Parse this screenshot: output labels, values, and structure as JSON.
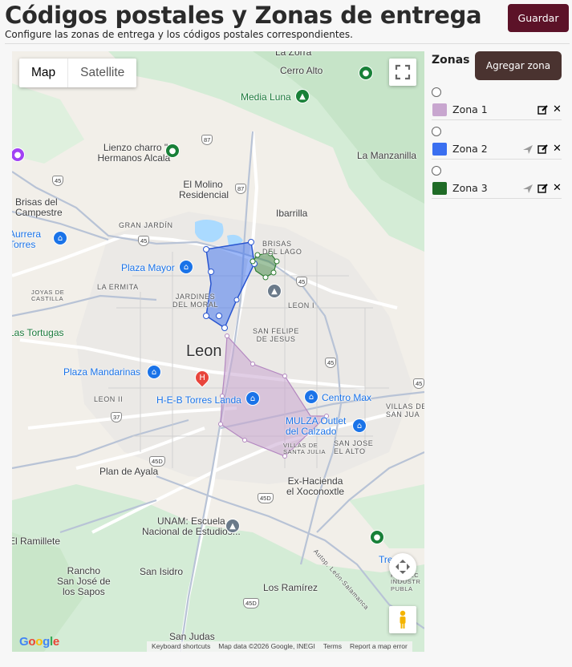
{
  "header": {
    "title": "Códigos postales y Zonas de entrega",
    "subtitle": "Configure las zonas de entrega y los códigos postales correspondientes.",
    "save_label": "Guardar"
  },
  "map": {
    "type_options": [
      "Map",
      "Satellite"
    ],
    "selected_type": "Map",
    "labels": {
      "la_zorra": "La Zorra",
      "cerro_alto": "Cerro Alto",
      "media_luna": "Media Luna",
      "lienzo": "Lienzo charro \"\nHermanos Alcalá\"",
      "la_manzanilla": "La Manzanilla",
      "el_molino": "El Molino\nResidencial",
      "brisas_campestre": "Brisas del\nCampestre",
      "ibarrilla": "Ibarrilla",
      "gran_jardin": "GRAN JARDÍN",
      "aurrera": "Aurrera\nTorres",
      "brisas_lago": "BRISAS\nDEL LAGO",
      "plaza_mayor": "Plaza Mayor",
      "la_ermita": "LA ERMITA",
      "joyas_castilla": "JOYAS DE\nCASTILLA",
      "jardines_moral": "JARDINES\nDEL MORAL",
      "leon_i": "LEON I",
      "las_tortugas": "Las Tortugas",
      "san_felipe": "SAN FELIPE\nDE JESUS",
      "leon": "Leon",
      "plaza_mandarinas": "Plaza Mandarinas",
      "leon_ii": "LEON II",
      "heb": "H-E-B Torres Landa",
      "centro_max": "Centro Max",
      "villas_san_juan": "VILLAS DE\nSAN JUA",
      "mulza": "MULZA Outlet\ndel Calzado",
      "san_jose_alto": "SAN JOSE\nEL ALTO",
      "villas_santa_julia": "VILLAS DE\nSANTA JULIA",
      "plan_ayala": "Plan de Ayala",
      "ex_hacienda": "Ex-Hacienda\nel Xoconoxtle",
      "unam": "UNAM: Escuela\nNacional de Estudios...",
      "el_ramillete": "El Ramillete",
      "rancho": "Rancho\nSan José de\nlos Sapos",
      "san_isidro": "San Isidro",
      "los_ramirez": "Los Ramírez",
      "san_judas": "San Judas",
      "autopista": "Autop. León-Salamanca",
      "tre": "Tre",
      "proyec": "PROYEC\nINDUSTR\nPUBLA"
    },
    "shields": [
      "87",
      "87",
      "45",
      "45",
      "45",
      "45",
      "37",
      "45D",
      "45D",
      "45D",
      "45"
    ],
    "google_logo": "Google",
    "attribution": {
      "shortcuts": "Keyboard shortcuts",
      "data": "Map data ©2026 Google, INEGI",
      "terms": "Terms",
      "report": "Report a map error"
    },
    "zone_polygons": {
      "zona_1_color": "#c8a6cf",
      "zona_2_color": "#3a6ff0",
      "zona_3_color": "#2e7d32"
    }
  },
  "zones_panel": {
    "title": "Zonas",
    "add_label": "Agregar zona",
    "zones": [
      {
        "name": "Zona 1",
        "color": "#c8a6cf",
        "has_send": false
      },
      {
        "name": "Zona 2",
        "color": "#3a6ff0",
        "has_send": true
      },
      {
        "name": "Zona 3",
        "color": "#1f6b26",
        "has_send": true
      }
    ]
  },
  "colors": {
    "primary_button": "#5c1228",
    "secondary_button": "#4a3330"
  }
}
